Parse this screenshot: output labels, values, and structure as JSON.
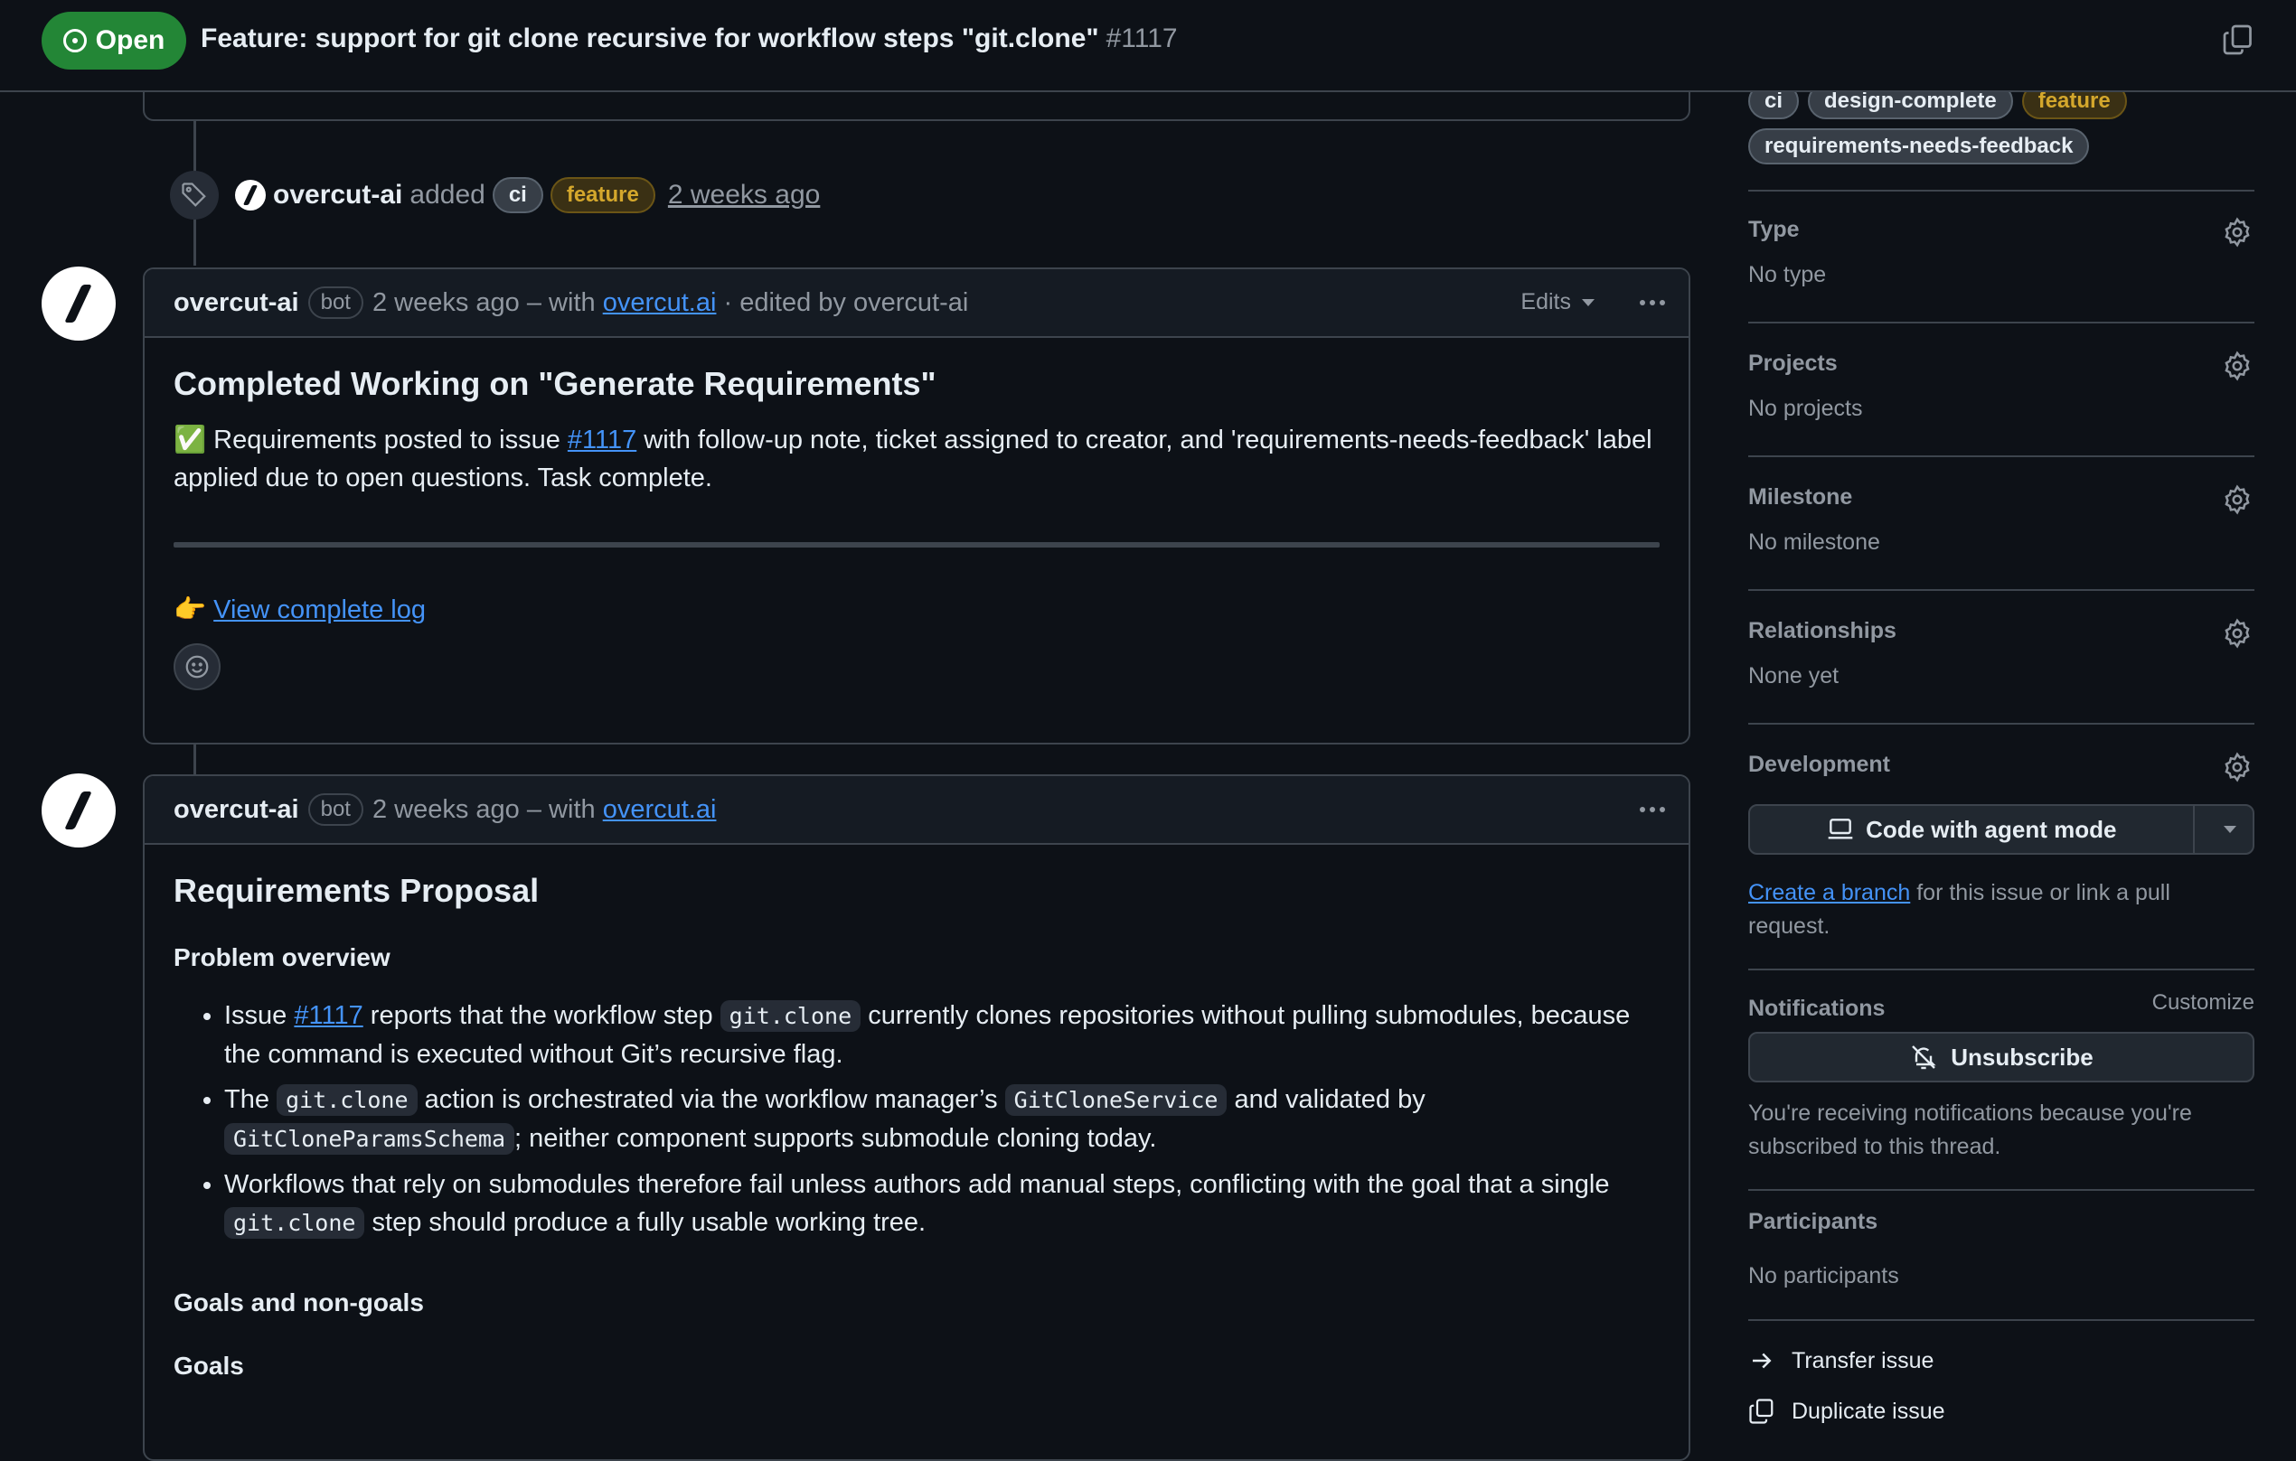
{
  "header": {
    "state_label": "Open",
    "title": "Feature: support for git clone recursive for workflow steps \"git.clone\"",
    "number": "#1117"
  },
  "label_event": {
    "actor": "overcut-ai",
    "verb": "added",
    "labels": [
      "ci",
      "feature"
    ],
    "time": "2 weeks ago"
  },
  "comment1": {
    "author": "overcut-ai",
    "badge": "bot",
    "meta_time": "2 weeks ago – with",
    "meta_link": "overcut.ai",
    "meta_edited": "· edited by overcut-ai",
    "edits_label": "Edits",
    "heading": "Completed Working on \"Generate Requirements\"",
    "para_emoji": "✅",
    "para_prefix": "Requirements posted to issue",
    "para_link": "#1117",
    "para_rest": "with follow-up note, ticket assigned to creator, and 'requirements-needs-feedback' label applied due to open questions. Task complete.",
    "log_emoji": "👉",
    "log_link": "View complete log"
  },
  "comment2": {
    "author": "overcut-ai",
    "badge": "bot",
    "meta_time": "2 weeks ago – with",
    "meta_link": "overcut.ai",
    "heading": "Requirements Proposal",
    "problem_heading": "Problem overview",
    "b1_a": "Issue",
    "b1_link": "#1117",
    "b1_b": "reports that the workflow step",
    "b1_code": "git.clone",
    "b1_c": "currently clones repositories without pulling submodules, because the command is executed without Git’s recursive flag.",
    "b2_a": "The",
    "b2_code1": "git.clone",
    "b2_b": "action is orchestrated via the workflow manager’s",
    "b2_code2": "GitCloneService",
    "b2_c": "and validated by",
    "b2_code3": "GitCloneParamsSchema",
    "b2_d": "; neither component supports submodule cloning today.",
    "b3_a": "Workflows that rely on submodules therefore fail unless authors add manual steps, conflicting with the goal that a single",
    "b3_code": "git.clone",
    "b3_b": "step should produce a fully usable working tree.",
    "goals_heading": "Goals and non-goals",
    "goals_sub": "Goals"
  },
  "sidebar": {
    "labels": [
      "ci",
      "design-complete",
      "feature",
      "requirements-needs-feedback"
    ],
    "type_title": "Type",
    "type_value": "No type",
    "projects_title": "Projects",
    "projects_value": "No projects",
    "milestone_title": "Milestone",
    "milestone_value": "No milestone",
    "relationships_title": "Relationships",
    "relationships_value": "None yet",
    "development_title": "Development",
    "code_agent_label": "Code with agent mode",
    "create_branch_link": "Create a branch",
    "create_branch_text": "for this issue or link a pull request.",
    "notifications_title": "Notifications",
    "customize_label": "Customize",
    "unsubscribe_label": "Unsubscribe",
    "notifications_text": "You're receiving notifications because you're subscribed to this thread.",
    "participants_title": "Participants",
    "participants_value": "No participants",
    "transfer_label": "Transfer issue",
    "duplicate_label": "Duplicate issue"
  },
  "colors": {
    "open_green": "#238636",
    "link_blue": "#4493f8",
    "feature_label": "#d4a72c"
  },
  "icons": [
    "issue-opened-icon",
    "copy-icon",
    "tag-icon",
    "kebab-icon",
    "smiley-icon",
    "gear-icon",
    "laptop-icon",
    "bell-slash-icon",
    "arrow-right-icon",
    "duplicate-icon"
  ]
}
